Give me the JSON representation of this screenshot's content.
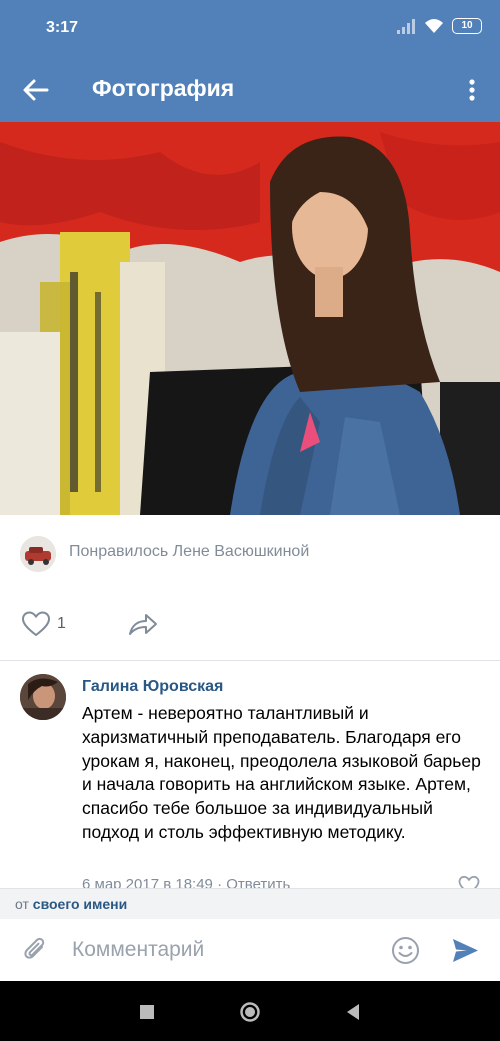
{
  "status_bar": {
    "time": "3:17",
    "battery": "10",
    "icons": [
      "signal-icon",
      "wifi-icon",
      "battery-icon"
    ]
  },
  "app_bar": {
    "title": "Фотография",
    "back_icon": "back-arrow-icon",
    "menu_icon": "more-vertical-icon",
    "color": "#5181b8"
  },
  "likes_line": {
    "text": "Понравилось Лене Васюшкиной"
  },
  "actions": {
    "like_count": "1",
    "like_icon": "heart-outline-icon",
    "share_icon": "share-arrow-icon"
  },
  "comment": {
    "author": "Галина Юровская",
    "text": "Артем - невероятно талантливый и харизматичный преподаватель. Благодаря его урокам я, наконец, преодолела языковой барьер и начала говорить на английском языке. Артем, спасибо тебе большое за индивидуальный подход и столь эффективную методику.",
    "date": "6 мар 2017 в 18:49",
    "separator": "·",
    "reply": "Ответить"
  },
  "from_bar": {
    "prefix": "от",
    "link": "своего имени"
  },
  "composer": {
    "placeholder": "Комментарий",
    "value": ""
  },
  "colors": {
    "accent": "#5181b8",
    "link": "#2a5885",
    "secondary_text": "#818c99"
  }
}
